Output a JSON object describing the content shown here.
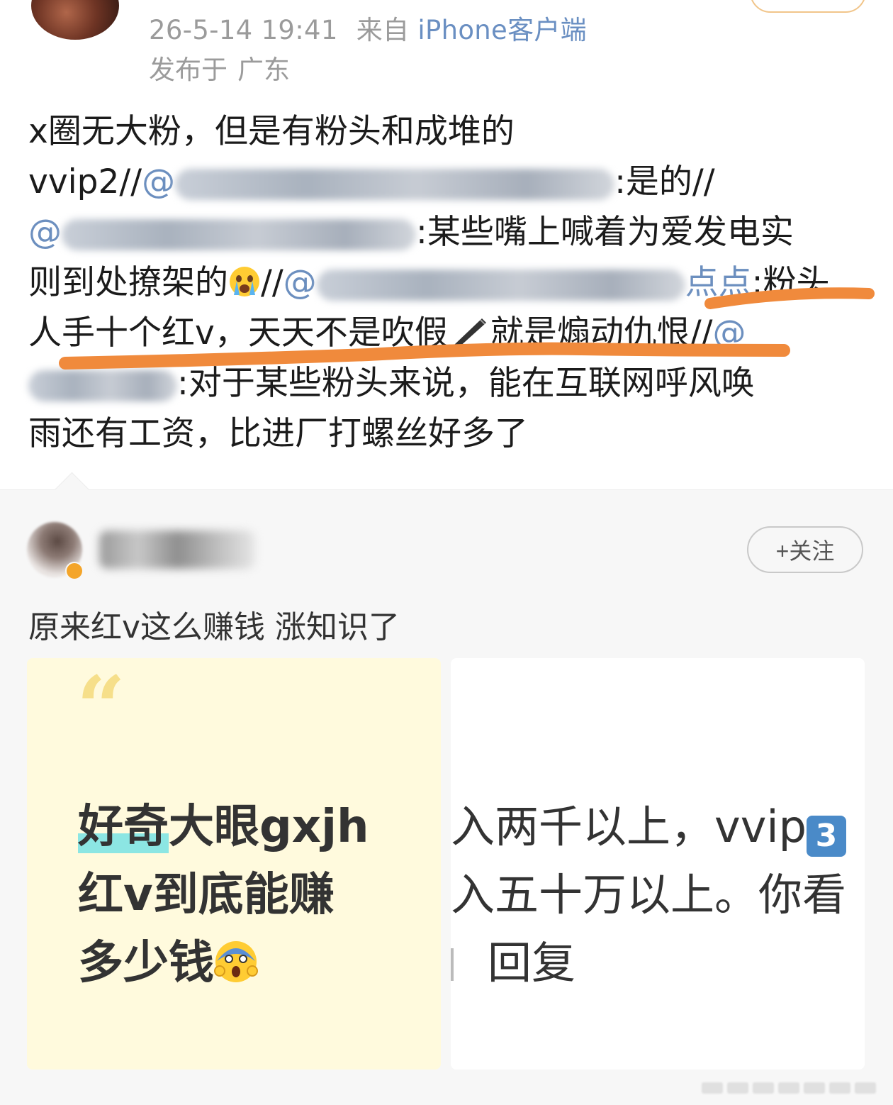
{
  "post": {
    "timestamp": "26-5-14 19:41",
    "source_prefix": "来自",
    "source_client": "iPhone客户端",
    "location_prefix": "发布于",
    "location": "广东",
    "text": {
      "line1": "x圈无大粉，但是有粉头和成堆的",
      "line2_prefix": "vvip2//",
      "mention_at": "@",
      "line2_suffix": ":是的//",
      "line3_suffix": ":某些嘴上喊着为爱发电实",
      "line4_prefix": "则到处撩架的",
      "line4_slashes": "//",
      "line4_mention_end": "点点",
      "line4_suffix": ":粉头",
      "line5_a": "人手十个红v，天天不是吹假",
      "line5_b": "就是煽动仇恨//",
      "line6_suffix": ":对于某些粉头来说，能在互联网呼风唤",
      "line7": "雨还有工资，比进厂打螺丝好多了"
    },
    "emoji_crying": "crying-face-emoji",
    "emoji_pen": "pen-icon",
    "annotation_color": "#f08a3c"
  },
  "comment": {
    "follow_label": "+关注",
    "text": "原来红v这么赚钱 涨知识了",
    "card_left": {
      "quote": "“",
      "line1_highlight": "好奇",
      "line1_rest": "大眼gxjh",
      "line2": "红v到底能赚",
      "line3": "多少钱",
      "emoji": "screaming-face-emoji"
    },
    "card_right": {
      "line1": "入两千以上，vvip",
      "keycap": "3",
      "line2": "入五十万以上。你看",
      "reply": "回复"
    }
  },
  "colors": {
    "mention": "#6c8fbf",
    "meta_gray": "#9b9b9b",
    "card_left_bg": "#fffadd",
    "highlight": "#8ce6e3"
  }
}
